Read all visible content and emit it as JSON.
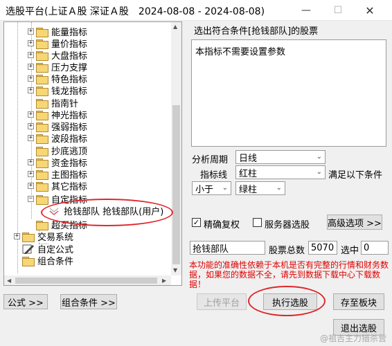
{
  "window": {
    "title": "选股平台(上证Ａ股 深证Ａ股　2024-08-08 - 2024-08-08)",
    "minimize_glyph": "—",
    "maximize_glyph": "☐",
    "close_glyph": "✕"
  },
  "tree": {
    "items": [
      {
        "label": "能量指标",
        "icon": "folder-icon"
      },
      {
        "label": "量价指标",
        "icon": "folder-icon"
      },
      {
        "label": "大盘指标",
        "icon": "folder-icon"
      },
      {
        "label": "压力支撑",
        "icon": "folder-icon"
      },
      {
        "label": "特色指标",
        "icon": "folder-icon"
      },
      {
        "label": "钱龙指标",
        "icon": "folder-icon"
      },
      {
        "label": "指南针",
        "icon": "folder-icon"
      },
      {
        "label": "神光指标",
        "icon": "folder-icon"
      },
      {
        "label": "强弱指标",
        "icon": "folder-icon"
      },
      {
        "label": "波段指标",
        "icon": "folder-icon"
      },
      {
        "label": "抄底逃顶",
        "icon": "folder-icon"
      },
      {
        "label": "资金指标",
        "icon": "folder-icon"
      },
      {
        "label": "主图指标",
        "icon": "folder-icon"
      },
      {
        "label": "其它指标",
        "icon": "folder-icon"
      },
      {
        "label": "自定指标",
        "icon": "folder-icon"
      },
      {
        "label": "抢钱部队  抢钱部队(用户)",
        "icon": "formula-icon"
      },
      {
        "label": "超买指标",
        "icon": "folder-icon"
      },
      {
        "label": "交易系统",
        "icon": "red-arrow-folder-icon"
      },
      {
        "label": "自定公式",
        "icon": "pencil-icon"
      },
      {
        "label": "组合条件",
        "icon": "folder-icon"
      }
    ],
    "expander_plus": "+",
    "expander_minus": "−"
  },
  "buttons": {
    "formula": "公式 >>",
    "combo_condition": "组合条件 >>",
    "upload": "上传平台",
    "execute": "执行选股",
    "save_block": "存至板块",
    "exit": "退出选股",
    "advanced": "高级选项 >>"
  },
  "condition": {
    "header": "选出符合条件[抢钱部队]的股票",
    "description": "本指标不需要设置参数",
    "period_label": "分析周期",
    "period_value": "日线",
    "indicator_label": "指标线",
    "indicator_value": "红柱",
    "satisfy_label": "满足以下条件",
    "compare_value": "小于",
    "target_value": "绿柱"
  },
  "options": {
    "exact_restore_label": "精确复权",
    "exact_restore_checked": true,
    "check_glyph": "✓",
    "server_select_label": "服务器选股",
    "server_select_checked": false
  },
  "stats": {
    "formula_name": "抢钱部队",
    "total_label": "股票总数",
    "total_value": "5070",
    "selected_label": "选中",
    "selected_value": "0"
  },
  "notice": "本功能的准确性依赖于本机是否有完整的行情和财务数据，如果您的数据不全，请先到数据下载中心下载数据！",
  "watermark": "@祖吉主力猎杀营",
  "colors": {
    "notice": "#e00000",
    "callout": "#e0262a",
    "folder": "#f6d675"
  }
}
